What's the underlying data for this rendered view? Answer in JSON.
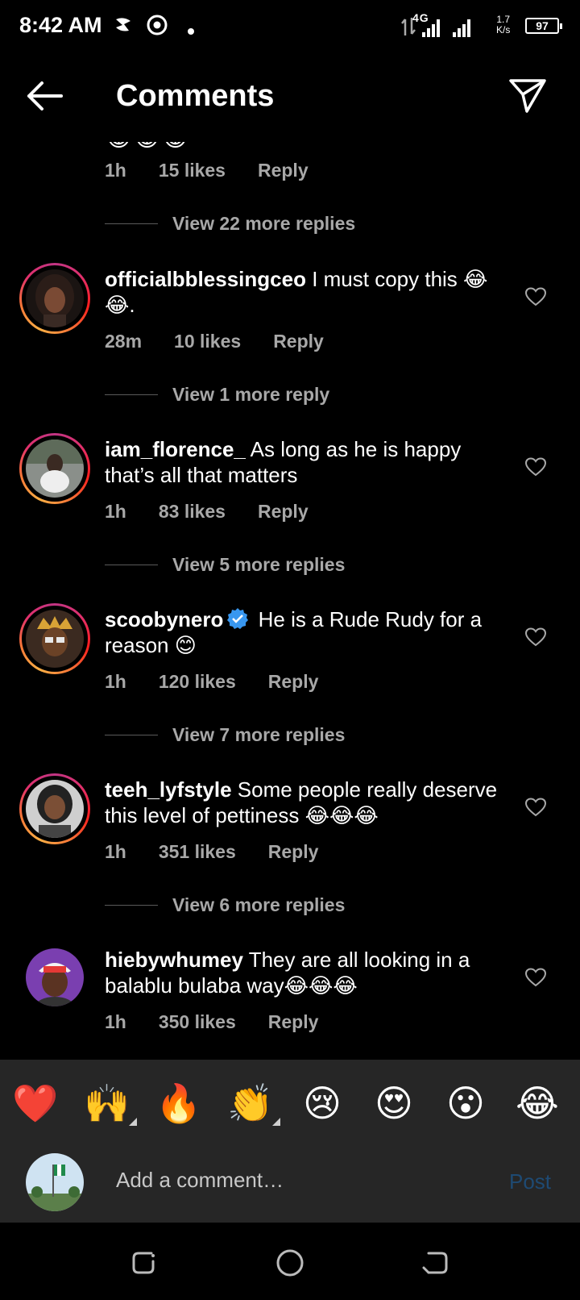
{
  "status_bar": {
    "time": "8:42 AM",
    "network": "4G",
    "speed_value": "1.7",
    "speed_unit": "K/s",
    "battery": "97"
  },
  "header": {
    "title": "Comments",
    "back_icon": "arrow-left-icon",
    "share_icon": "paper-plane-icon"
  },
  "top_partial": {
    "emoji": "😂😂😂",
    "time": "1h",
    "likes": "15 likes",
    "reply": "Reply",
    "view_more": "View 22 more replies"
  },
  "comments": [
    {
      "username": "officialbblessingceo",
      "text": "I must copy this 😂😂.",
      "time": "28m",
      "likes": "10 likes",
      "reply": "Reply",
      "view_more": "View 1 more reply",
      "verified": false
    },
    {
      "username": "iam_florence_",
      "text": "As long as he is happy that’s all that matters",
      "time": "1h",
      "likes": "83 likes",
      "reply": "Reply",
      "view_more": "View 5 more replies",
      "verified": false
    },
    {
      "username": "scoobynero",
      "text": "He is a Rude Rudy for a reason 😊",
      "time": "1h",
      "likes": "120 likes",
      "reply": "Reply",
      "view_more": "View 7 more replies",
      "verified": true
    },
    {
      "username": "teeh_lyfstyle",
      "text": "Some people really deserve this level of pettiness 😂😂😂",
      "time": "1h",
      "likes": "351 likes",
      "reply": "Reply",
      "view_more": "View 6 more replies",
      "verified": false
    },
    {
      "username": "hiebywhumey",
      "text": "They are all looking in a balablu bulaba way😂😂😂",
      "time": "1h",
      "likes": "350 likes",
      "reply": "Reply",
      "verified": false
    }
  ],
  "quick_emojis": [
    "❤️",
    "🙌",
    "🔥",
    "👏",
    "😢",
    "😍",
    "😮",
    "😂"
  ],
  "input": {
    "placeholder": "Add a comment…",
    "post_label": "Post"
  },
  "colors": {
    "background": "#000000",
    "panel": "#262626",
    "secondary_text": "#a8a8a8",
    "post_disabled": "#1e4a73",
    "verified": "#3897f0"
  }
}
